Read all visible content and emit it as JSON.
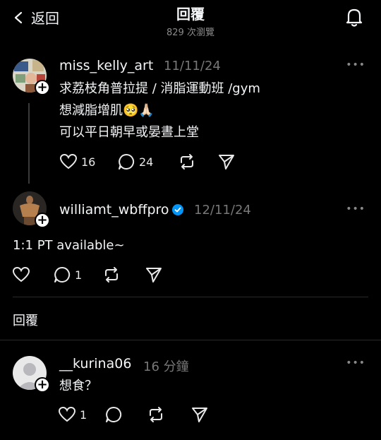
{
  "header": {
    "back_label": "返回",
    "title": "回覆",
    "views": "829 次瀏覽"
  },
  "posts": [
    {
      "username": "miss_kelly_art",
      "date": "11/11/24",
      "lines": [
        "求荔枝角普拉提 / 消脂運動班 /gym",
        "想減脂增肌🥺🙏🏻",
        "可以平日朝早或晏晝上堂"
      ],
      "likes": "16",
      "comments": "24"
    },
    {
      "username": "williamt_wbffpro",
      "date": "12/11/24",
      "lines": [
        "1:1 PT available~"
      ],
      "likes": "",
      "comments": "1"
    }
  ],
  "replies_section_label": "回覆",
  "reply": {
    "username": "__kurina06",
    "date": "16 分鐘",
    "text": "想食？",
    "likes": "1"
  }
}
